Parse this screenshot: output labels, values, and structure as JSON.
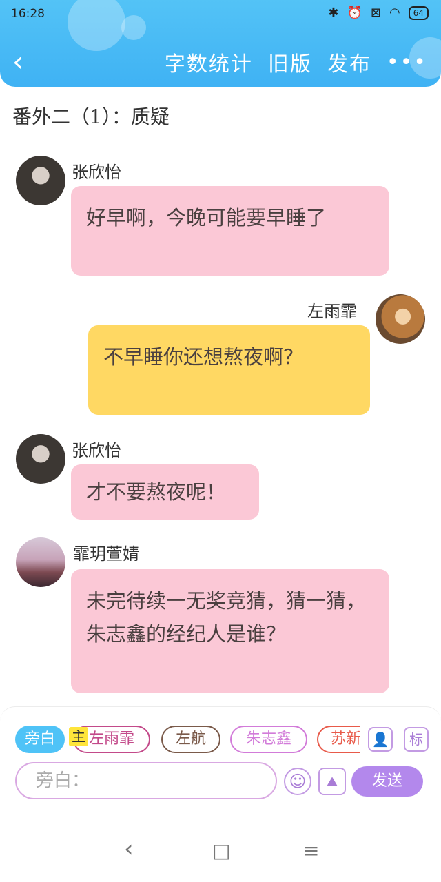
{
  "status": {
    "time": "16:28",
    "battery": "64"
  },
  "header": {
    "back": "‹",
    "actions": [
      "字数统计",
      "旧版",
      "发布"
    ],
    "more": "•••"
  },
  "chapter_title": "番外二（1）：质疑",
  "messages": [
    {
      "sender": "张欣怡",
      "text": "好早啊，今晚可能要早睡了"
    },
    {
      "sender": "左雨霏",
      "text": "不早睡你还想熬夜啊？"
    },
    {
      "sender": "张欣怡",
      "text": "才不要熬夜呢！"
    },
    {
      "sender": "霏玥萱婧",
      "text": "未完待续一无奖竞猜，猜一猜，朱志鑫的经纪人是谁？"
    }
  ],
  "composer": {
    "chips": [
      "旁白",
      "主",
      "左雨霏",
      "左航",
      "朱志鑫",
      "苏新"
    ],
    "placeholder": "旁白：",
    "send": "发送",
    "tag_icon": "标"
  },
  "icons": {
    "person": "person-card-icon",
    "emoji": "emoji-icon",
    "image": "image-icon"
  },
  "sysnav": {
    "back": "‹",
    "home": "□",
    "menu": "≡"
  }
}
